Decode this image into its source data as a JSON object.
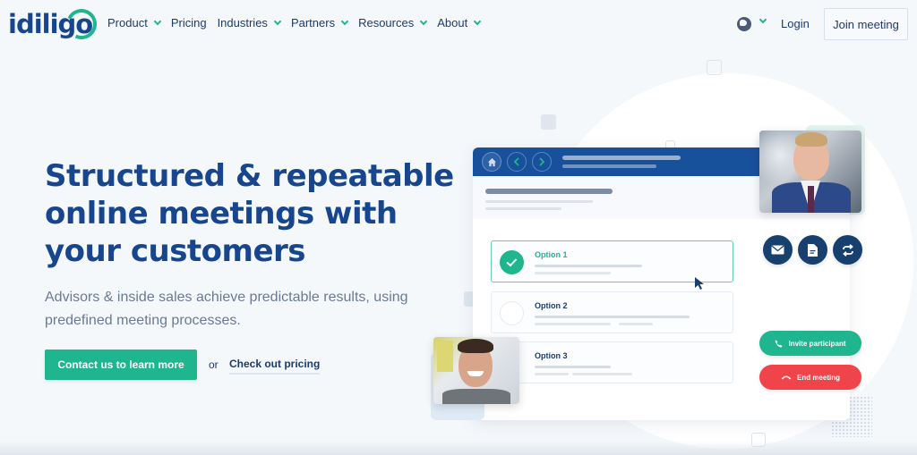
{
  "brand": {
    "name": "idiligo",
    "accent": "#1fb58f",
    "primary": "#17468f"
  },
  "nav": {
    "items": [
      {
        "label": "Product",
        "dropdown": true
      },
      {
        "label": "Pricing",
        "dropdown": false
      },
      {
        "label": "Industries",
        "dropdown": true
      },
      {
        "label": "Partners",
        "dropdown": true
      },
      {
        "label": "Resources",
        "dropdown": true
      },
      {
        "label": "About",
        "dropdown": true
      }
    ],
    "language_icon": "globe-icon",
    "login": "Login",
    "join_meeting": "Join meeting"
  },
  "hero": {
    "headline": "Structured & repeatable online meetings with your customers",
    "subtext": "Advisors & inside sales achieve predictable results, using predefined meeting processes.",
    "cta_primary": "Contact us to learn more",
    "or": "or",
    "cta_secondary": "Check out pricing"
  },
  "mockup": {
    "nav_icons": [
      "home-icon",
      "chevron-left-icon",
      "chevron-right-icon"
    ],
    "options": [
      {
        "label": "Option 1",
        "selected": true
      },
      {
        "label": "Option 2",
        "selected": false
      },
      {
        "label": "Option 3",
        "selected": false
      }
    ],
    "actions": [
      "mail-icon",
      "document-icon",
      "swap-icon"
    ],
    "invite_label": "Invite participant",
    "end_label": "End meeting",
    "invite_color": "#1fb58f",
    "end_color": "#ef4449"
  }
}
